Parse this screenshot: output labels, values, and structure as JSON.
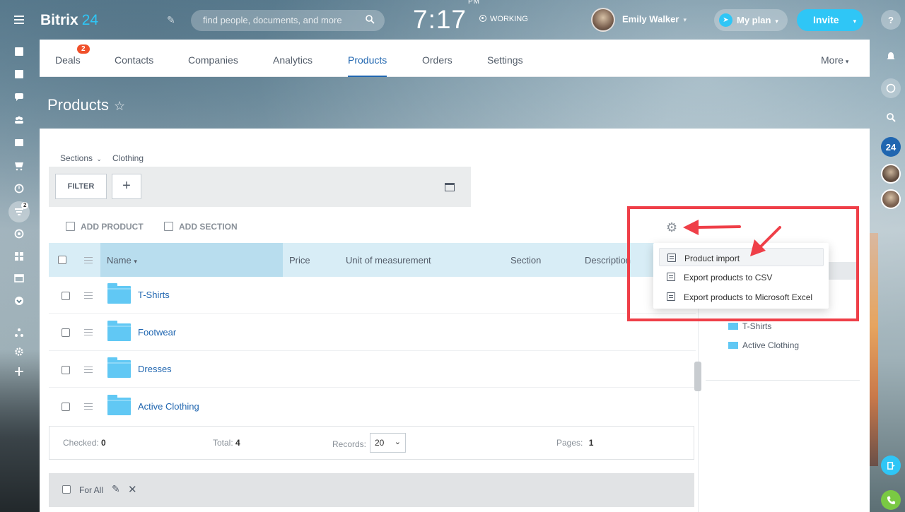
{
  "app": {
    "logo_name": "Bitrix",
    "logo_num": "24"
  },
  "header": {
    "search_placeholder": "find people, documents, and more",
    "time": "7:17",
    "ampm": "PM",
    "status": "WORKING",
    "user_name": "Emily Walker",
    "plan_label": "My plan",
    "invite_label": "Invite"
  },
  "tabs": [
    {
      "label": "Deals",
      "badge": "2"
    },
    {
      "label": "Contacts"
    },
    {
      "label": "Companies"
    },
    {
      "label": "Analytics"
    },
    {
      "label": "Products",
      "active": true
    },
    {
      "label": "Orders"
    },
    {
      "label": "Settings"
    },
    {
      "label": "More"
    }
  ],
  "page": {
    "title": "Products"
  },
  "breadcrumb": {
    "sections": "Sections",
    "current": "Clothing"
  },
  "filter": {
    "filter_label": "FILTER",
    "plus_label": "+"
  },
  "actions": {
    "add_product": "ADD PRODUCT",
    "add_section": "ADD SECTION"
  },
  "table": {
    "columns": [
      "Name",
      "Price",
      "Unit of measurement",
      "Section",
      "Description"
    ],
    "rows": [
      {
        "name": "T-Shirts"
      },
      {
        "name": "Footwear"
      },
      {
        "name": "Dresses"
      },
      {
        "name": "Active Clothing"
      }
    ]
  },
  "footer": {
    "checked_label": "Checked:",
    "checked_value": "0",
    "total_label": "Total:",
    "total_value": "4",
    "records_label": "Records:",
    "records_value": "20",
    "pages_label": "Pages:",
    "pages_value": "1"
  },
  "group_actions": {
    "for_all": "For All"
  },
  "settings_menu": {
    "items": [
      "Product import",
      "Export products to CSV",
      "Export products to Microsoft Excel"
    ]
  },
  "section_tree": {
    "items": [
      "T-Shirts",
      "Active Clothing"
    ]
  },
  "right_bar": {
    "counter": "24"
  },
  "left_bar": {
    "badge": "2"
  },
  "colors": {
    "accent": "#2fc6f6",
    "link": "#2066b0",
    "badge": "#f0502a",
    "annotation": "#ef3f48",
    "folder": "#61c8f4"
  }
}
